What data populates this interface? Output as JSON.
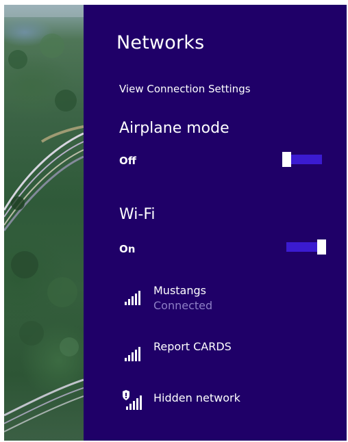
{
  "panel": {
    "title": "Networks",
    "view_settings_link": "View Connection Settings",
    "background_color": "#1f0068",
    "accent_color": "#3b1bd0"
  },
  "airplane_mode": {
    "heading": "Airplane mode",
    "state_label": "Off",
    "enabled": false
  },
  "wifi": {
    "heading": "Wi-Fi",
    "state_label": "On",
    "enabled": true
  },
  "networks": [
    {
      "name": "Mustangs",
      "status": "Connected",
      "icon": "wifi-signal-icon",
      "secured": true
    },
    {
      "name": "Report CARDS",
      "status": "",
      "icon": "wifi-signal-icon",
      "secured": true
    },
    {
      "name": "Hidden network",
      "status": "",
      "icon": "wifi-signal-shield-icon",
      "secured": false
    }
  ]
}
